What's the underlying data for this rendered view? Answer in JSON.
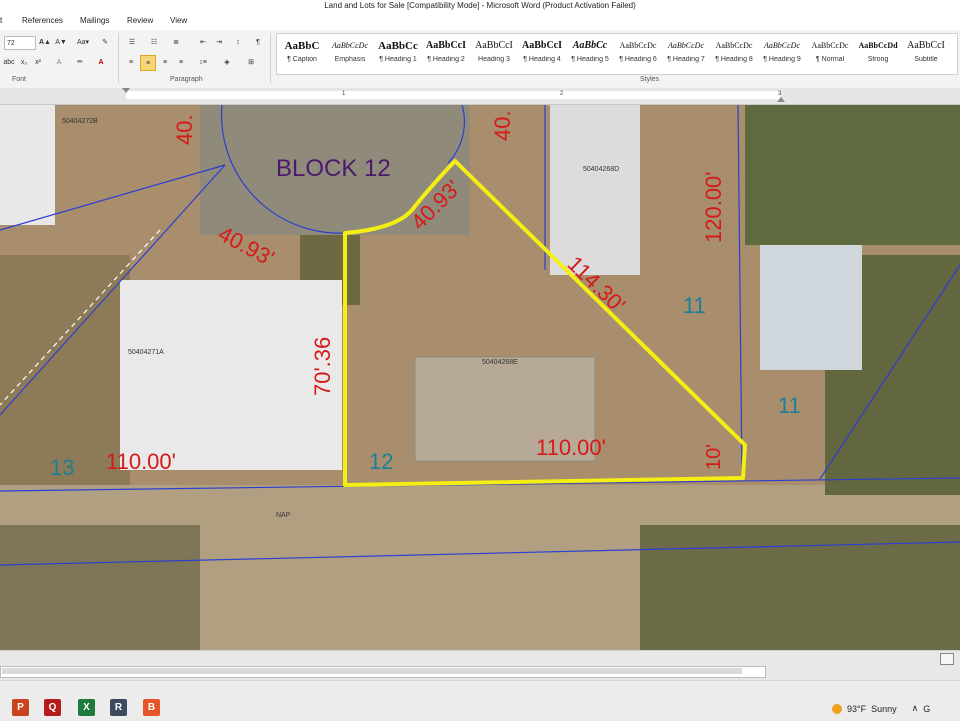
{
  "window": {
    "title": "Land and Lots for Sale [Compatibility Mode]  -  Microsoft Word (Product Activation Failed)"
  },
  "menu": {
    "tabs": [
      "t",
      "References",
      "Mailings",
      "Review",
      "View"
    ]
  },
  "ribbon": {
    "font_size": "72",
    "font_group_label": "Font",
    "paragraph_group_label": "Paragraph",
    "styles_group_label": "Styles",
    "styles": [
      {
        "sample": "AaBbC",
        "name": "¶ Caption"
      },
      {
        "sample": "AaBbCcDc",
        "name": "Emphasis"
      },
      {
        "sample": "AaBbCc",
        "name": "¶ Heading 1"
      },
      {
        "sample": "AaBbCcI",
        "name": "¶ Heading 2"
      },
      {
        "sample": "AaBbCcI",
        "name": "Heading 3"
      },
      {
        "sample": "AaBbCcI",
        "name": "¶ Heading 4"
      },
      {
        "sample": "AaBbCc",
        "name": "¶ Heading 5"
      },
      {
        "sample": "AaBbCcDc",
        "name": "¶ Heading 6"
      },
      {
        "sample": "AaBbCcDc",
        "name": "¶ Heading 7"
      },
      {
        "sample": "AaBbCcDc",
        "name": "¶ Heading 8"
      },
      {
        "sample": "AaBbCcDc",
        "name": "¶ Heading 9"
      },
      {
        "sample": "AaBbCcDc",
        "name": "¶ Normal"
      },
      {
        "sample": "AaBbCcDd",
        "name": "Strong"
      },
      {
        "sample": "AaBbCcI",
        "name": "Subtitle"
      }
    ]
  },
  "ruler": {
    "numbers": [
      "1",
      "2",
      "3"
    ]
  },
  "map": {
    "block_label": "BLOCK 12",
    "parcels": [
      "50404272B",
      "50404268D",
      "50404271A",
      "50404268E",
      "NAP"
    ],
    "lot_numbers": [
      "11",
      "11",
      "13",
      "12"
    ],
    "dimensions": [
      "40.",
      "40.",
      "40.93'",
      "40.93'",
      "114.30'",
      "120.00'",
      "70'.36",
      "110.00'",
      "110.00'",
      "10'"
    ],
    "colors": {
      "highlight": "#f5ee12",
      "dimension": "#d61a1a",
      "lot": "#1b7f9a",
      "block": "#4b1a6e",
      "line": "#2b3fd0"
    }
  },
  "taskbar": {
    "apps": [
      "P",
      "Q",
      "X",
      "R",
      "B"
    ],
    "temperature": "93°F",
    "condition": "Sunny",
    "tray_fragment": "G"
  }
}
